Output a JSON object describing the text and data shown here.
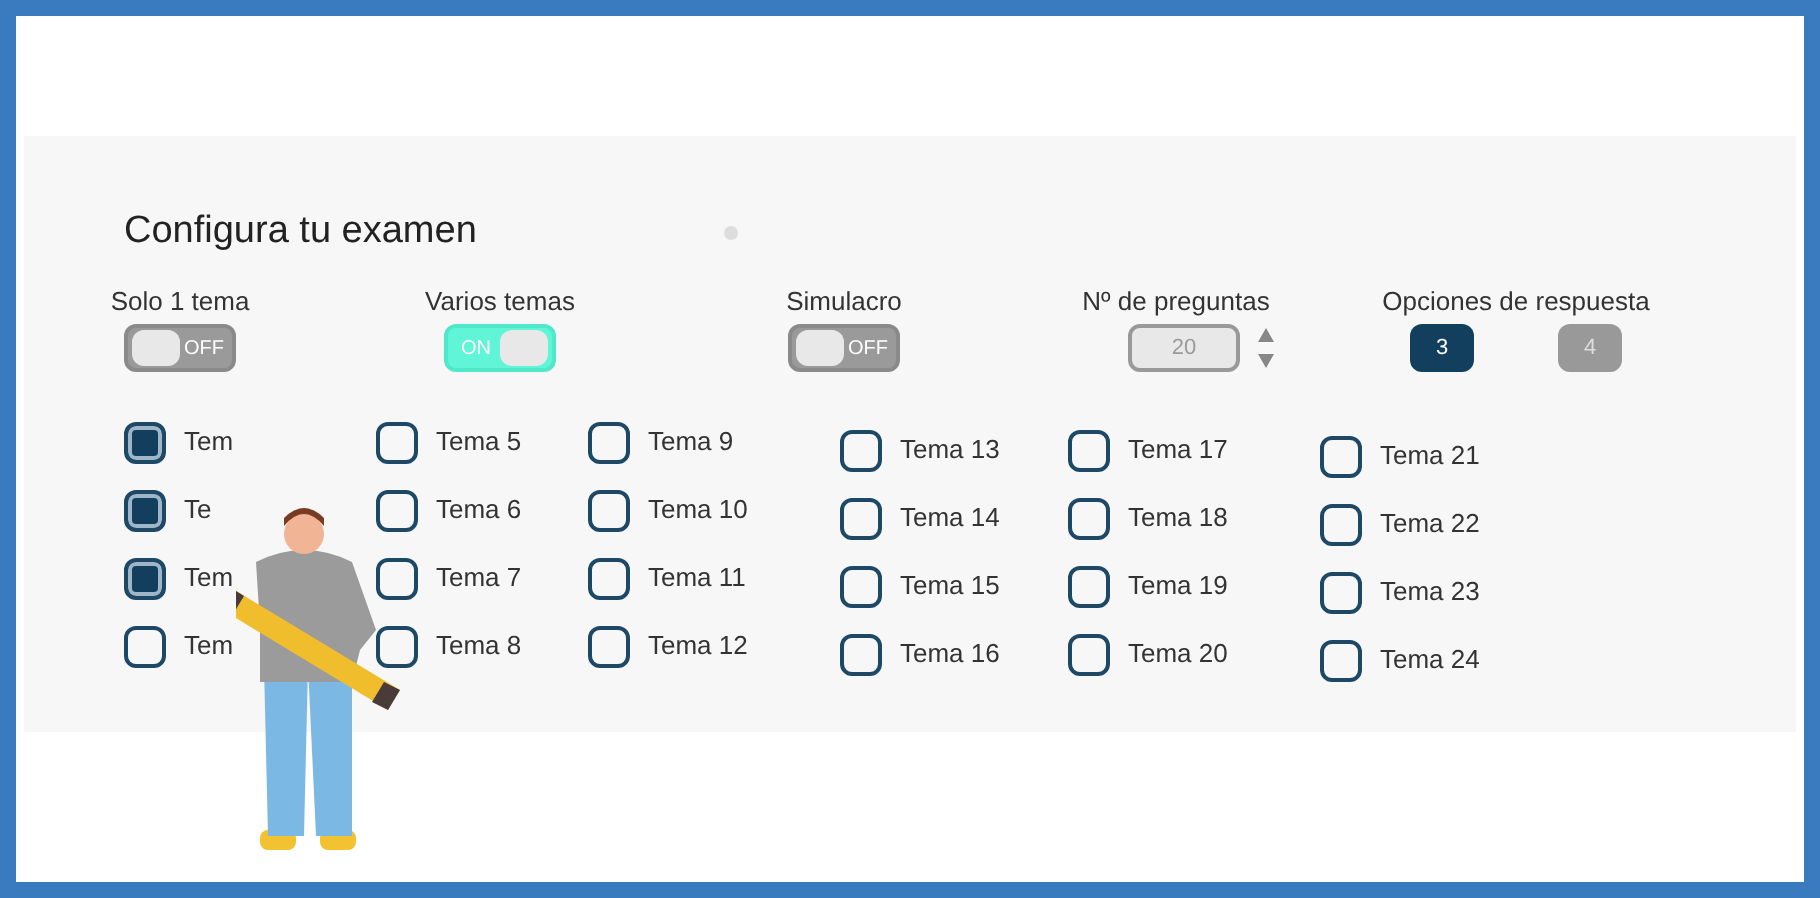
{
  "title": "Configura tu examen",
  "settings": [
    {
      "kind": "toggle",
      "label": "Solo 1 tema",
      "on": false,
      "state_text": "OFF"
    },
    {
      "kind": "toggle",
      "label": "Varios temas",
      "on": true,
      "state_text": "ON"
    },
    {
      "kind": "toggle",
      "label": "Simulacro",
      "on": false,
      "state_text": "OFF"
    },
    {
      "kind": "number",
      "label": "Nº de preguntas",
      "value": "20"
    },
    {
      "kind": "options",
      "label": "Opciones de respuesta",
      "options": [
        {
          "label": "3",
          "selected": true
        },
        {
          "label": "4",
          "selected": false
        }
      ]
    }
  ],
  "topics": [
    {
      "label": "Tem",
      "checked": true
    },
    {
      "label": "Te",
      "checked": true
    },
    {
      "label": "Tem",
      "checked": true
    },
    {
      "label": "Tem",
      "checked": false
    },
    {
      "label": "Tema 5",
      "checked": false
    },
    {
      "label": "Tema 6",
      "checked": false
    },
    {
      "label": "Tema 7",
      "checked": false
    },
    {
      "label": "Tema 8",
      "checked": false
    },
    {
      "label": "Tema 9",
      "checked": false
    },
    {
      "label": "Tema 10",
      "checked": false
    },
    {
      "label": "Tema 11",
      "checked": false
    },
    {
      "label": "Tema 12",
      "checked": false
    },
    {
      "label": "Tema 13",
      "checked": false
    },
    {
      "label": "Tema 14",
      "checked": false
    },
    {
      "label": "Tema 15",
      "checked": false
    },
    {
      "label": "Tema 16",
      "checked": false
    },
    {
      "label": "Tema 17",
      "checked": false
    },
    {
      "label": "Tema 18",
      "checked": false
    },
    {
      "label": "Tema 19",
      "checked": false
    },
    {
      "label": "Tema 20",
      "checked": false
    },
    {
      "label": "Tema 21",
      "checked": false
    },
    {
      "label": "Tema 22",
      "checked": false
    },
    {
      "label": "Tema 23",
      "checked": false
    },
    {
      "label": "Tema 24",
      "checked": false
    }
  ]
}
